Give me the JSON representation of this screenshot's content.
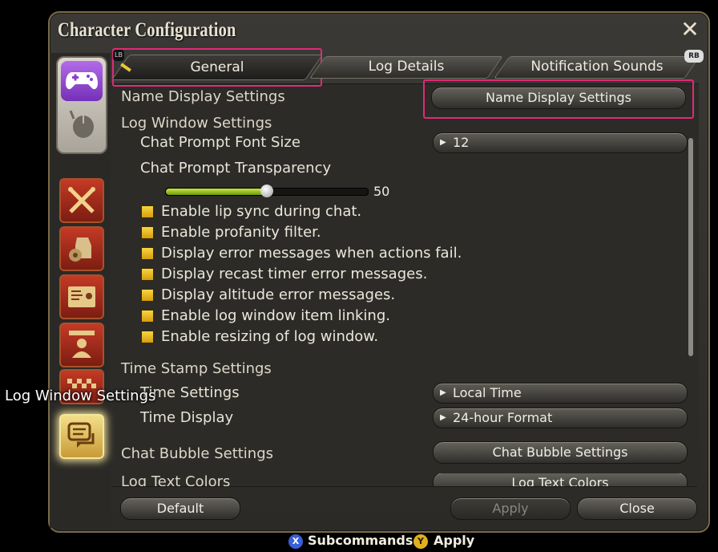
{
  "window": {
    "title": "Character Configuration"
  },
  "tabs": [
    {
      "label": "General",
      "badge": "LB"
    },
    {
      "label": "Log Details"
    },
    {
      "label": "Notification Sounds",
      "badge": "RB"
    }
  ],
  "sections": {
    "name_display": {
      "label": "Name Display Settings",
      "button": "Name Display Settings"
    },
    "log_window": {
      "label": "Log Window Settings",
      "font_size_label": "Chat Prompt Font Size",
      "font_size_value": "12",
      "transparency_label": "Chat Prompt Transparency",
      "transparency_value": "50",
      "transparency_fraction": 0.5,
      "checkboxes": [
        "Enable lip sync during chat.",
        "Enable profanity filter.",
        "Display error messages when actions fail.",
        "Display recast timer error messages.",
        "Display altitude error messages.",
        "Enable log window item linking.",
        "Enable resizing of log window."
      ]
    },
    "time_stamp": {
      "label": "Time Stamp Settings",
      "time_settings_label": "Time Settings",
      "time_settings_value": "Local Time",
      "time_display_label": "Time Display",
      "time_display_value": "24-hour Format"
    },
    "chat_bubble": {
      "label": "Chat Bubble Settings",
      "button": "Chat Bubble Settings"
    },
    "log_text_colors": {
      "label": "Log Text Colors",
      "button": "Log Text Colors"
    }
  },
  "footer": {
    "default": "Default",
    "apply": "Apply",
    "close": "Close"
  },
  "tooltip": "Log Window Settings",
  "hints": [
    {
      "button": "X",
      "label": "Subcommands",
      "color": "#3a5fd8"
    },
    {
      "button": "Y",
      "label": "Apply",
      "color": "#e0b020"
    }
  ],
  "colors": {
    "highlight": "#e02a77",
    "checkbox": "#f0c020",
    "slider": "#a6cc28"
  },
  "icons": [
    "close-icon",
    "gamepad-icon",
    "mouse-icon",
    "crossed-swords-icon",
    "bag-gear-icon",
    "id-card-icon",
    "character-icon",
    "checkered-icon",
    "chat-bubbles-icon",
    "play-arrow-icon"
  ]
}
